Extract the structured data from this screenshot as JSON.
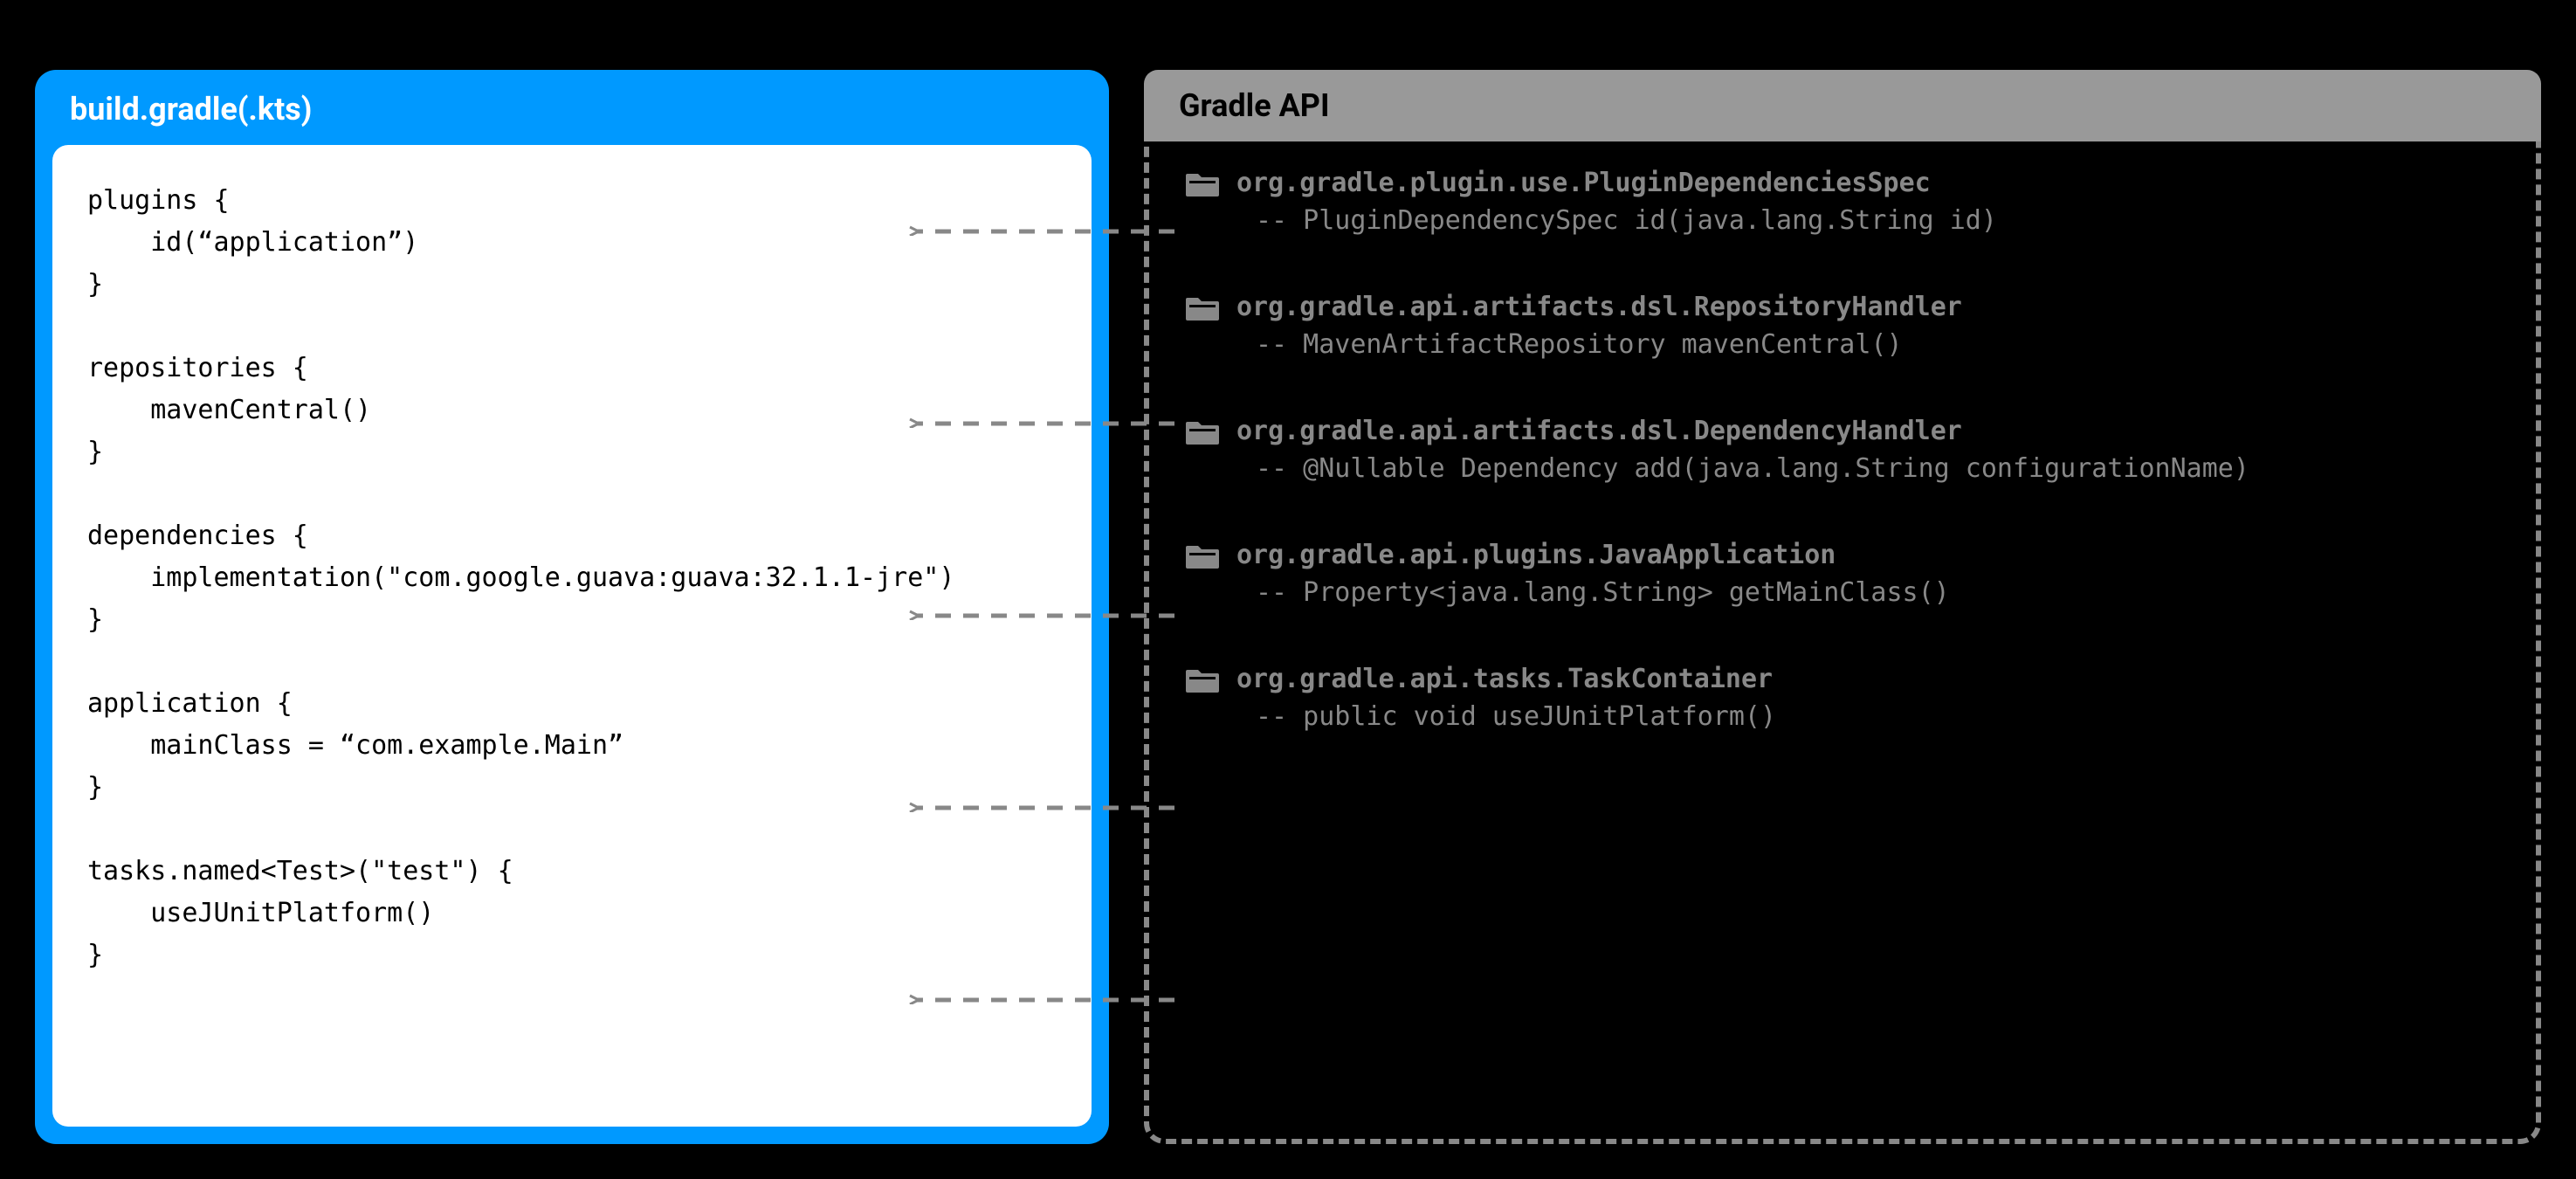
{
  "left": {
    "title": "build.gradle(.kts)",
    "code_blocks": [
      "plugins {\n    id(“application”)\n}",
      "repositories {\n    mavenCentral()\n}",
      "dependencies {\n    implementation(\"com.google.guava:guava:32.1.1-jre\")\n}",
      "application {\n    mainClass = “com.example.Main”\n}",
      "tasks.named<Test>(\"test\") {\n    useJUnitPlatform()\n}"
    ]
  },
  "right": {
    "title": "Gradle API",
    "items": [
      {
        "class": "org.gradle.plugin.use.PluginDependenciesSpec",
        "method": "-- PluginDependencySpec id(java.lang.String id)"
      },
      {
        "class": "org.gradle.api.artifacts.dsl.RepositoryHandler",
        "method": "-- MavenArtifactRepository mavenCentral()"
      },
      {
        "class": "org.gradle.api.artifacts.dsl.DependencyHandler",
        "method": "-- @Nullable Dependency add(java.lang.String configurationName)"
      },
      {
        "class": "org.gradle.api.plugins.JavaApplication",
        "method": "-- Property<java.lang.String> getMainClass()"
      },
      {
        "class": "org.gradle.api.tasks.TaskContainer",
        "method": "-- public void useJUnitPlatform()"
      }
    ]
  }
}
